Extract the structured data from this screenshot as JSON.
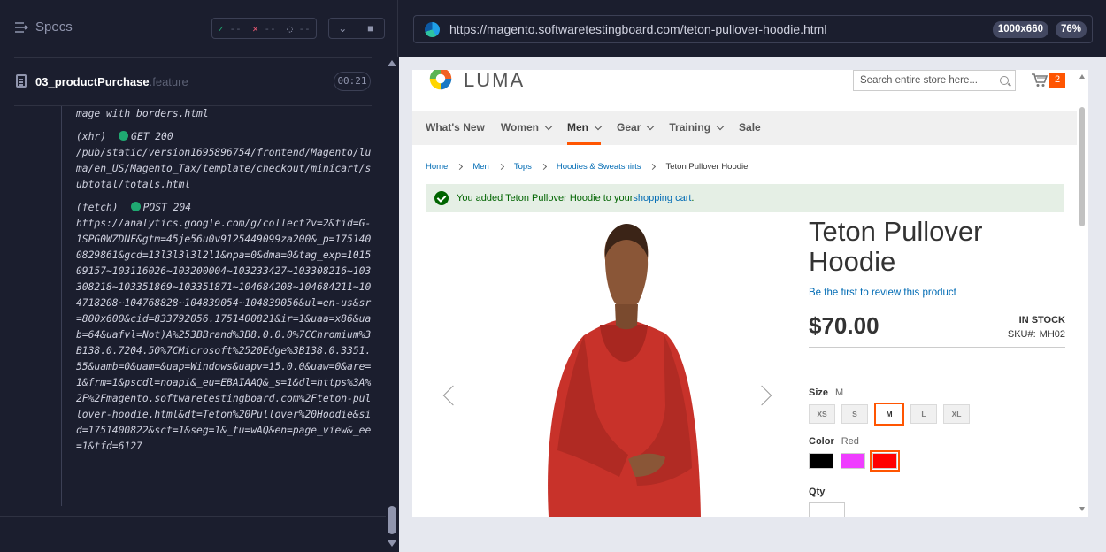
{
  "runner": {
    "specs_label": "Specs",
    "stats": {
      "passed": "--",
      "failed": "--",
      "pending": "--"
    },
    "file_name": "03_productPurchase",
    "file_ext": ".feature",
    "duration": "00:21",
    "log": [
      {
        "type": "",
        "method": "",
        "url": "mage_with_borders.html"
      },
      {
        "type": "(xhr)",
        "method": "GET 200",
        "url": "/pub/static/version1695896754/frontend/Magento/luma/en_US/Magento_Tax/template/checkout/minicart/subtotal/totals.html"
      },
      {
        "type": "(fetch)",
        "method": "POST 204",
        "url": "https://analytics.google.com/g/collect?v=2&tid=G-1SPG0WZDNF&gtm=45je56u0v9125449099za200&_p=1751400829861&gcd=13l3l3l3l2l1&npa=0&dma=0&tag_exp=101509157~103116026~103200004~103233427~103308216~103308218~103351869~103351871~104684208~104684211~104718208~104768828~104839054~104839056&ul=en-us&sr=800x600&cid=833792056.1751400821&ir=1&uaa=x86&uab=64&uafvl=Not)A%253BBrand%3B8.0.0.0%7CChromium%3B138.0.7204.50%7CMicrosoft%2520Edge%3B138.0.3351.55&uamb=0&uam=&uap=Windows&uapv=15.0.0&uaw=0&are=1&frm=1&pscdl=noapi&_eu=EBAIAAQ&_s=1&dl=https%3A%2F%2Fmagento.softwaretestingboard.com%2Fteton-pullover-hoodie.html&dt=Teton%20Pullover%20Hoodie&sid=1751400822&sct=1&seg=1&_tu=wAQ&en=page_view&_ee=1&tfd=6127"
      }
    ]
  },
  "browser": {
    "url": "https://magento.softwaretestingboard.com/teton-pullover-hoodie.html",
    "viewport_size": "1000x660",
    "zoom": "76%"
  },
  "store": {
    "logo_text": "LUMA",
    "search_placeholder": "Search entire store here...",
    "cart_count": "2",
    "nav": [
      {
        "label": "What's New",
        "chevron": false
      },
      {
        "label": "Women",
        "chevron": true
      },
      {
        "label": "Men",
        "chevron": true
      },
      {
        "label": "Gear",
        "chevron": true
      },
      {
        "label": "Training",
        "chevron": true
      },
      {
        "label": "Sale",
        "chevron": false
      }
    ],
    "breadcrumbs": [
      "Home",
      "Men",
      "Tops",
      "Hoodies & Sweatshirts",
      "Teton Pullover Hoodie"
    ],
    "message": {
      "text": "You added Teton Pullover Hoodie to your ",
      "link": "shopping cart",
      "end": "."
    },
    "product": {
      "title_line1": "Teton Pullover",
      "title_line2": "Hoodie",
      "review_link": "Be the first to review this product",
      "price": "$70.00",
      "stock": "IN STOCK",
      "sku_label": "SKU#:",
      "sku": "MH02",
      "size_label": "Size",
      "size_selected": "M",
      "sizes": [
        "XS",
        "S",
        "M",
        "L",
        "XL"
      ],
      "color_label": "Color",
      "color_selected": "Red",
      "colors": [
        {
          "name": "Black",
          "hex": "#000000"
        },
        {
          "name": "Purple",
          "hex": "#ef3dff"
        },
        {
          "name": "Red",
          "hex": "#ff0000"
        }
      ],
      "qty_label": "Qty"
    }
  }
}
